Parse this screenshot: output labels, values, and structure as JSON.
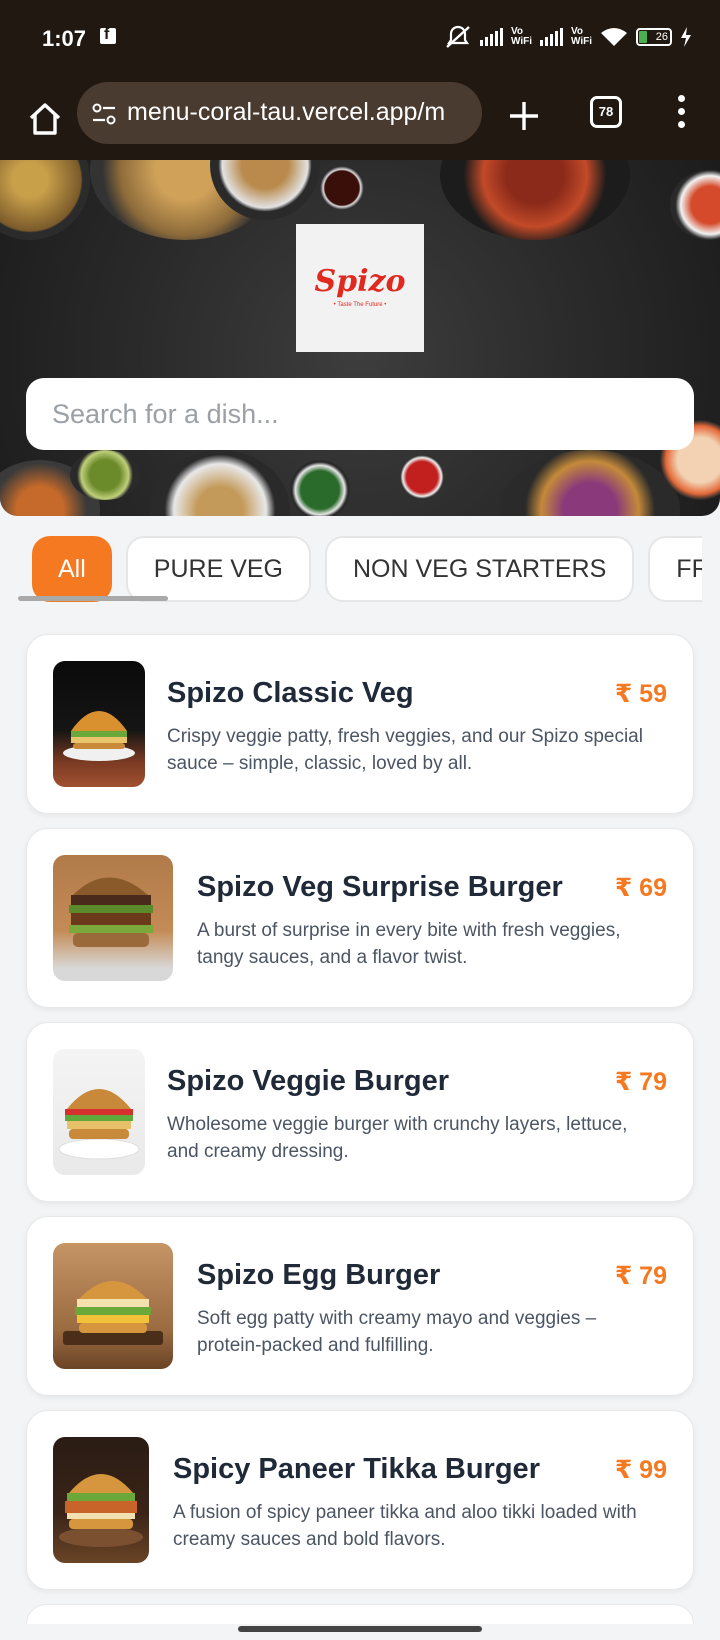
{
  "status_bar": {
    "time": "1:07",
    "battery_level": "26",
    "icons": [
      "facebook-icon",
      "mute-icon",
      "signal-icon",
      "vowifi-icon",
      "signal-icon",
      "vowifi-icon",
      "wifi-icon",
      "battery-icon",
      "charging-icon"
    ],
    "vowifi_label": "Vo\nWiFi"
  },
  "browser": {
    "url": "menu-coral-tau.vercel.app/m",
    "tab_count": "78",
    "icons": [
      "home-icon",
      "site-settings-icon",
      "new-tab-icon",
      "tabs-icon",
      "more-options-icon"
    ]
  },
  "hero": {
    "logo_text": "Spizo",
    "logo_tagline": "• Taste The Future •",
    "search_placeholder": "Search for a dish..."
  },
  "categories": [
    {
      "label": "All",
      "active": true
    },
    {
      "label": "PURE VEG",
      "active": false
    },
    {
      "label": "NON VEG STARTERS",
      "active": false
    },
    {
      "label": "FRIES",
      "active": false
    }
  ],
  "menu_items": [
    {
      "name": "Spizo Classic Veg",
      "price": "₹ 59",
      "description": "Crispy veggie patty, fresh veggies, and our Spizo special sauce – simple, classic, loved by all."
    },
    {
      "name": "Spizo Veg Surprise Burger",
      "price": "₹ 69",
      "description": "A burst of surprise in every bite with fresh veggies, tangy sauces, and a flavor twist."
    },
    {
      "name": "Spizo Veggie Burger",
      "price": "₹ 79",
      "description": "Wholesome veggie burger with crunchy layers, lettuce, and creamy dressing."
    },
    {
      "name": "Spizo Egg Burger",
      "price": "₹ 79",
      "description": "Soft egg patty with creamy mayo and veggies – protein-packed and fulfilling."
    },
    {
      "name": "Spicy Paneer Tikka Burger",
      "price": "₹ 99",
      "description": "A fusion of spicy paneer tikka and aloo tikki loaded with creamy sauces and bold flavors."
    }
  ],
  "colors": {
    "accent": "#f47920",
    "status_bar": "#211812",
    "url_pill": "#4a3b30"
  }
}
